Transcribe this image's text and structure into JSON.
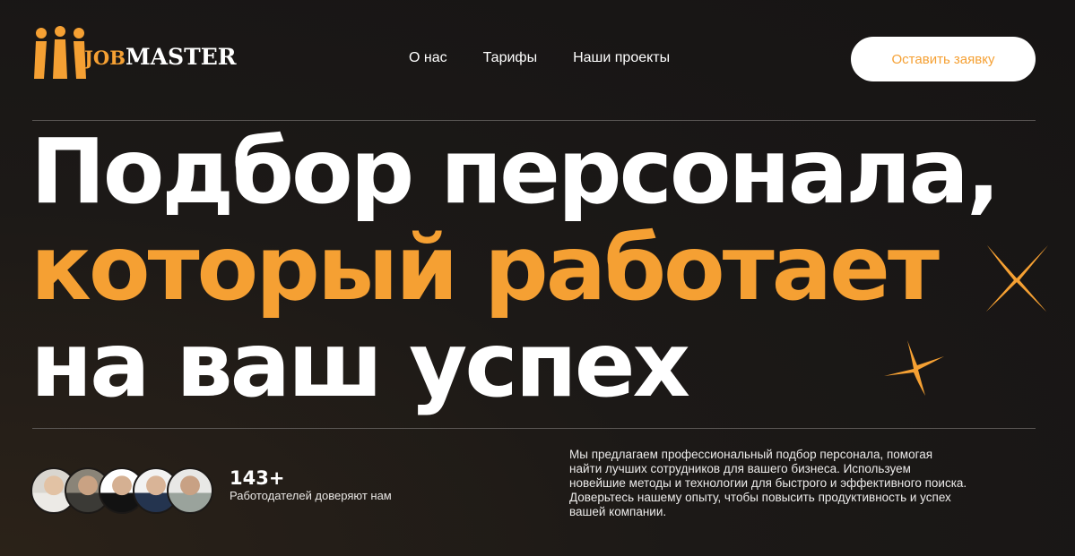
{
  "brand": {
    "job": "JOB",
    "master": "MASTER",
    "accent_color": "#f5a033"
  },
  "nav": {
    "items": [
      "О нас",
      "Тарифы",
      "Наши проекты"
    ]
  },
  "cta_label": "Оставить заявку",
  "hero": {
    "line1": "Подбор персонала,",
    "line2": "который работает",
    "line3": "на ваш успех"
  },
  "stats": {
    "count": "143+",
    "label": "Работодателей доверяют нам"
  },
  "avatars": [
    "avatar-1",
    "avatar-2",
    "avatar-3",
    "avatar-4",
    "avatar-5"
  ],
  "description_lines": [
    "Мы предлагаем профессиональный подбор персонала, помогая",
    "найти лучших сотрудников для вашего бизнеса. Используем",
    "новейшие методы и технологии для быстрого и эффективного поиска.",
    "Доверьтесь нашему опыту, чтобы повысить продуктивность и успех",
    "вашей компании."
  ]
}
